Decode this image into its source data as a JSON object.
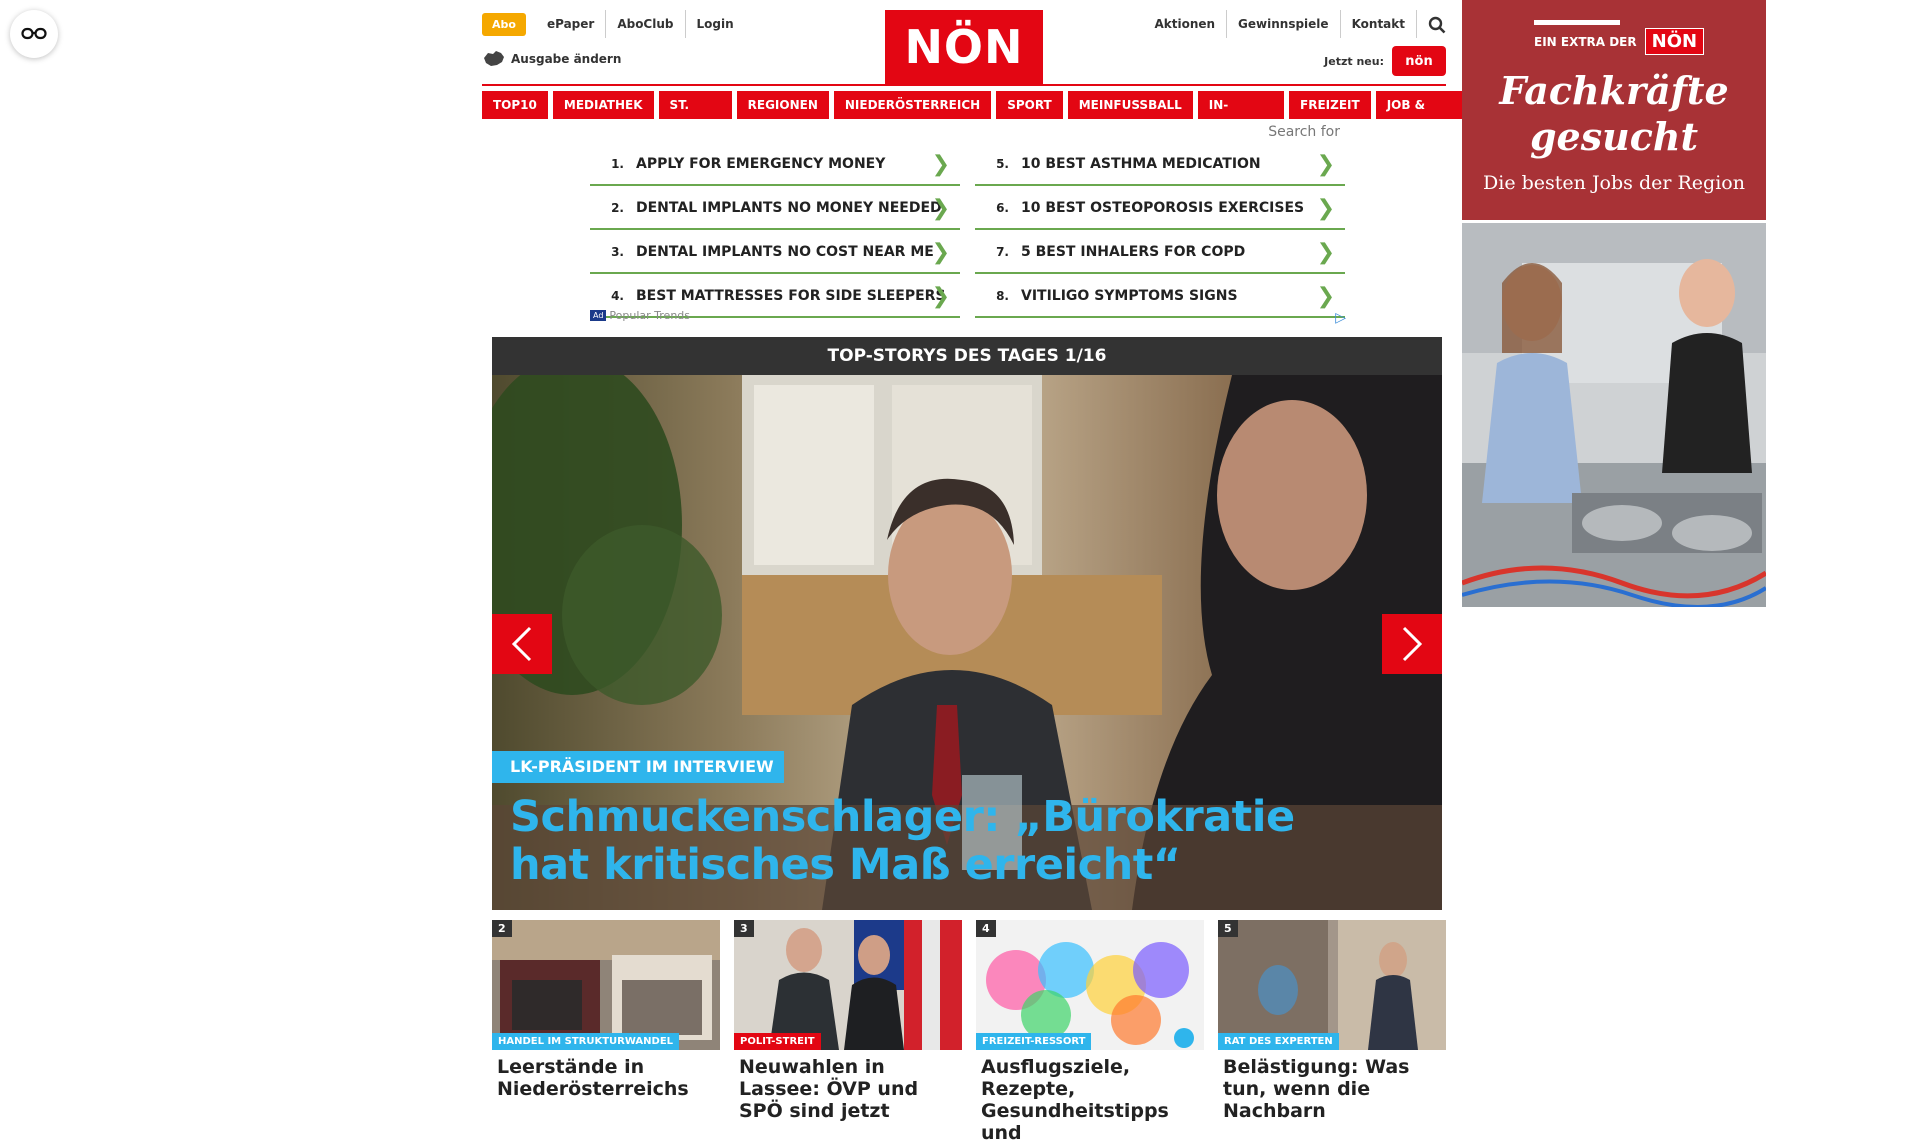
{
  "header": {
    "abo_label": "Abo",
    "links_left": [
      "ePaper",
      "AboClub",
      "Login"
    ],
    "ausgabe_label": "Ausgabe ändern",
    "logo_text": "NÖN",
    "links_right": [
      "Aktionen",
      "Gewinnspiele",
      "Kontakt"
    ],
    "jetzt_label": "Jetzt neu:",
    "jetzt_badge": "nön"
  },
  "nav": {
    "items": [
      "TOP10",
      "MEDIATHEK",
      "ST. PÖLTEN",
      "REGIONEN",
      "NIEDERÖSTERREICH",
      "SPORT",
      "MEINFUSSBALL",
      "IN-AUSLAND",
      "FREIZEIT",
      "JOB & KARRIERE"
    ]
  },
  "ad_block": {
    "search_label": "Search for",
    "left_items": [
      {
        "num": "1.",
        "text": "APPLY FOR EMERGENCY MONEY"
      },
      {
        "num": "2.",
        "text": "DENTAL IMPLANTS NO MONEY NEEDED"
      },
      {
        "num": "3.",
        "text": "DENTAL IMPLANTS NO COST NEAR ME"
      },
      {
        "num": "4.",
        "text": "BEST MATTRESSES FOR SIDE SLEEPERS"
      }
    ],
    "right_items": [
      {
        "num": "5.",
        "text": "10 BEST ASTHMA MEDICATION"
      },
      {
        "num": "6.",
        "text": "10 BEST OSTEOPOROSIS EXERCISES"
      },
      {
        "num": "7.",
        "text": "5 BEST INHALERS FOR COPD"
      },
      {
        "num": "8.",
        "text": "VITILIGO SYMPTOMS SIGNS"
      }
    ],
    "ad_badge": "Ad",
    "footer_text": "Popular Trends"
  },
  "top_stories": {
    "bar_title": "TOP-STORYS DES TAGES 1/16",
    "hero_tag": "LK-PRÄSIDENT IM INTERVIEW",
    "hero_title": "Schmuckenschlager: „Bürokratie hat kritisches Maß erreicht“",
    "thumbs": [
      {
        "num": "2",
        "tag": "HANDEL IM STRUKTURWANDEL",
        "tag_color": "#2fb5ec",
        "title": "Leerstände in Niederösterreichs"
      },
      {
        "num": "3",
        "tag": "POLIT-STREIT",
        "tag_color": "#e30613",
        "title": "Neuwahlen in Lassee: ÖVP und SPÖ sind jetzt"
      },
      {
        "num": "4",
        "tag": "FREIZEIT-RESSORT",
        "tag_color": "#2fb5ec",
        "title": "Ausflugsziele, Rezepte, Gesundheitstipps und"
      },
      {
        "num": "5",
        "tag": "RAT DES EXPERTEN",
        "tag_color": "#2fb5ec",
        "title": "Belästigung: Was tun, wenn die Nachbarn"
      }
    ]
  },
  "side_ad": {
    "extra_label": "EIN EXTRA DER",
    "extra_logo": "NÖN",
    "headline_line1": "Fachkräfte",
    "headline_line2": "gesucht",
    "subline": "Die besten Jobs der Region"
  },
  "colors": {
    "brand_red": "#e30613",
    "accent_blue": "#2fb5ec",
    "abo_orange": "#f5a800",
    "ad_green": "#6aa84f"
  }
}
